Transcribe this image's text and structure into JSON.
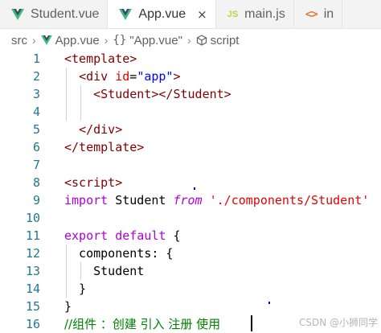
{
  "tabs": [
    {
      "label": "Student.vue",
      "icon": "vue-icon",
      "active": false
    },
    {
      "label": "App.vue",
      "icon": "vue-icon",
      "active": true,
      "close": "×"
    },
    {
      "label": "main.js",
      "icon": "js-icon",
      "icon_text": "JS",
      "active": false
    },
    {
      "label": "in",
      "icon": "code-icon",
      "icon_text": "<>",
      "active": false
    }
  ],
  "breadcrumb": {
    "root": "src",
    "file": "App.vue",
    "braces": "{}",
    "section": "\"App.vue\"",
    "node": "script"
  },
  "colors": {
    "vue_green": "#41b883",
    "vue_dark": "#35495e",
    "line_number": "#237893",
    "tag": "#800000",
    "attribute": "#e50000",
    "string": "#0000ff",
    "keyword": "#0000ff",
    "control_keyword": "#af00db",
    "comment": "#008000"
  },
  "lines": [
    {
      "num": "1",
      "tokens": [
        {
          "t": "<template>",
          "c": "tag"
        }
      ]
    },
    {
      "num": "2",
      "tokens": [
        {
          "t": "  "
        },
        {
          "t": "<div",
          "c": "tag"
        },
        {
          "t": " "
        },
        {
          "t": "id",
          "c": "attr"
        },
        {
          "t": "=",
          "c": "plain"
        },
        {
          "t": "\"app\"",
          "c": "str"
        },
        {
          "t": ">",
          "c": "tag"
        }
      ]
    },
    {
      "num": "3",
      "tokens": [
        {
          "t": "    "
        },
        {
          "t": "<Student></Student>",
          "c": "tag"
        }
      ]
    },
    {
      "num": "4",
      "tokens": []
    },
    {
      "num": "5",
      "tokens": [
        {
          "t": "  "
        },
        {
          "t": "</div>",
          "c": "tag"
        }
      ]
    },
    {
      "num": "6",
      "tokens": [
        {
          "t": "</template>",
          "c": "tag"
        }
      ]
    },
    {
      "num": "7",
      "tokens": []
    },
    {
      "num": "8",
      "tokens": [
        {
          "t": "<script>",
          "c": "tag"
        }
      ]
    },
    {
      "num": "9",
      "tokens": [
        {
          "t": "import",
          "c": "ctl"
        },
        {
          "t": " Student ",
          "c": "plain"
        },
        {
          "t": "from",
          "c": "ctl ital"
        },
        {
          "t": " "
        },
        {
          "t": "'./components/Student'",
          "c": "attr"
        }
      ]
    },
    {
      "num": "10",
      "tokens": []
    },
    {
      "num": "11",
      "tokens": [
        {
          "t": "export",
          "c": "ctl"
        },
        {
          "t": " "
        },
        {
          "t": "default",
          "c": "ctl"
        },
        {
          "t": " {",
          "c": "plain"
        }
      ]
    },
    {
      "num": "12",
      "tokens": [
        {
          "t": "  components: {",
          "c": "plain"
        }
      ]
    },
    {
      "num": "13",
      "tokens": [
        {
          "t": "    Student",
          "c": "plain"
        }
      ]
    },
    {
      "num": "14",
      "tokens": [
        {
          "t": "  }",
          "c": "plain"
        }
      ]
    },
    {
      "num": "15",
      "tokens": [
        {
          "t": "}",
          "c": "plain"
        }
      ]
    },
    {
      "num": "16",
      "tokens": [
        {
          "t": "//组件 ：创建 引入 注册 使用",
          "c": "cmt"
        }
      ]
    }
  ],
  "watermark": "CSDN @小狮同学"
}
